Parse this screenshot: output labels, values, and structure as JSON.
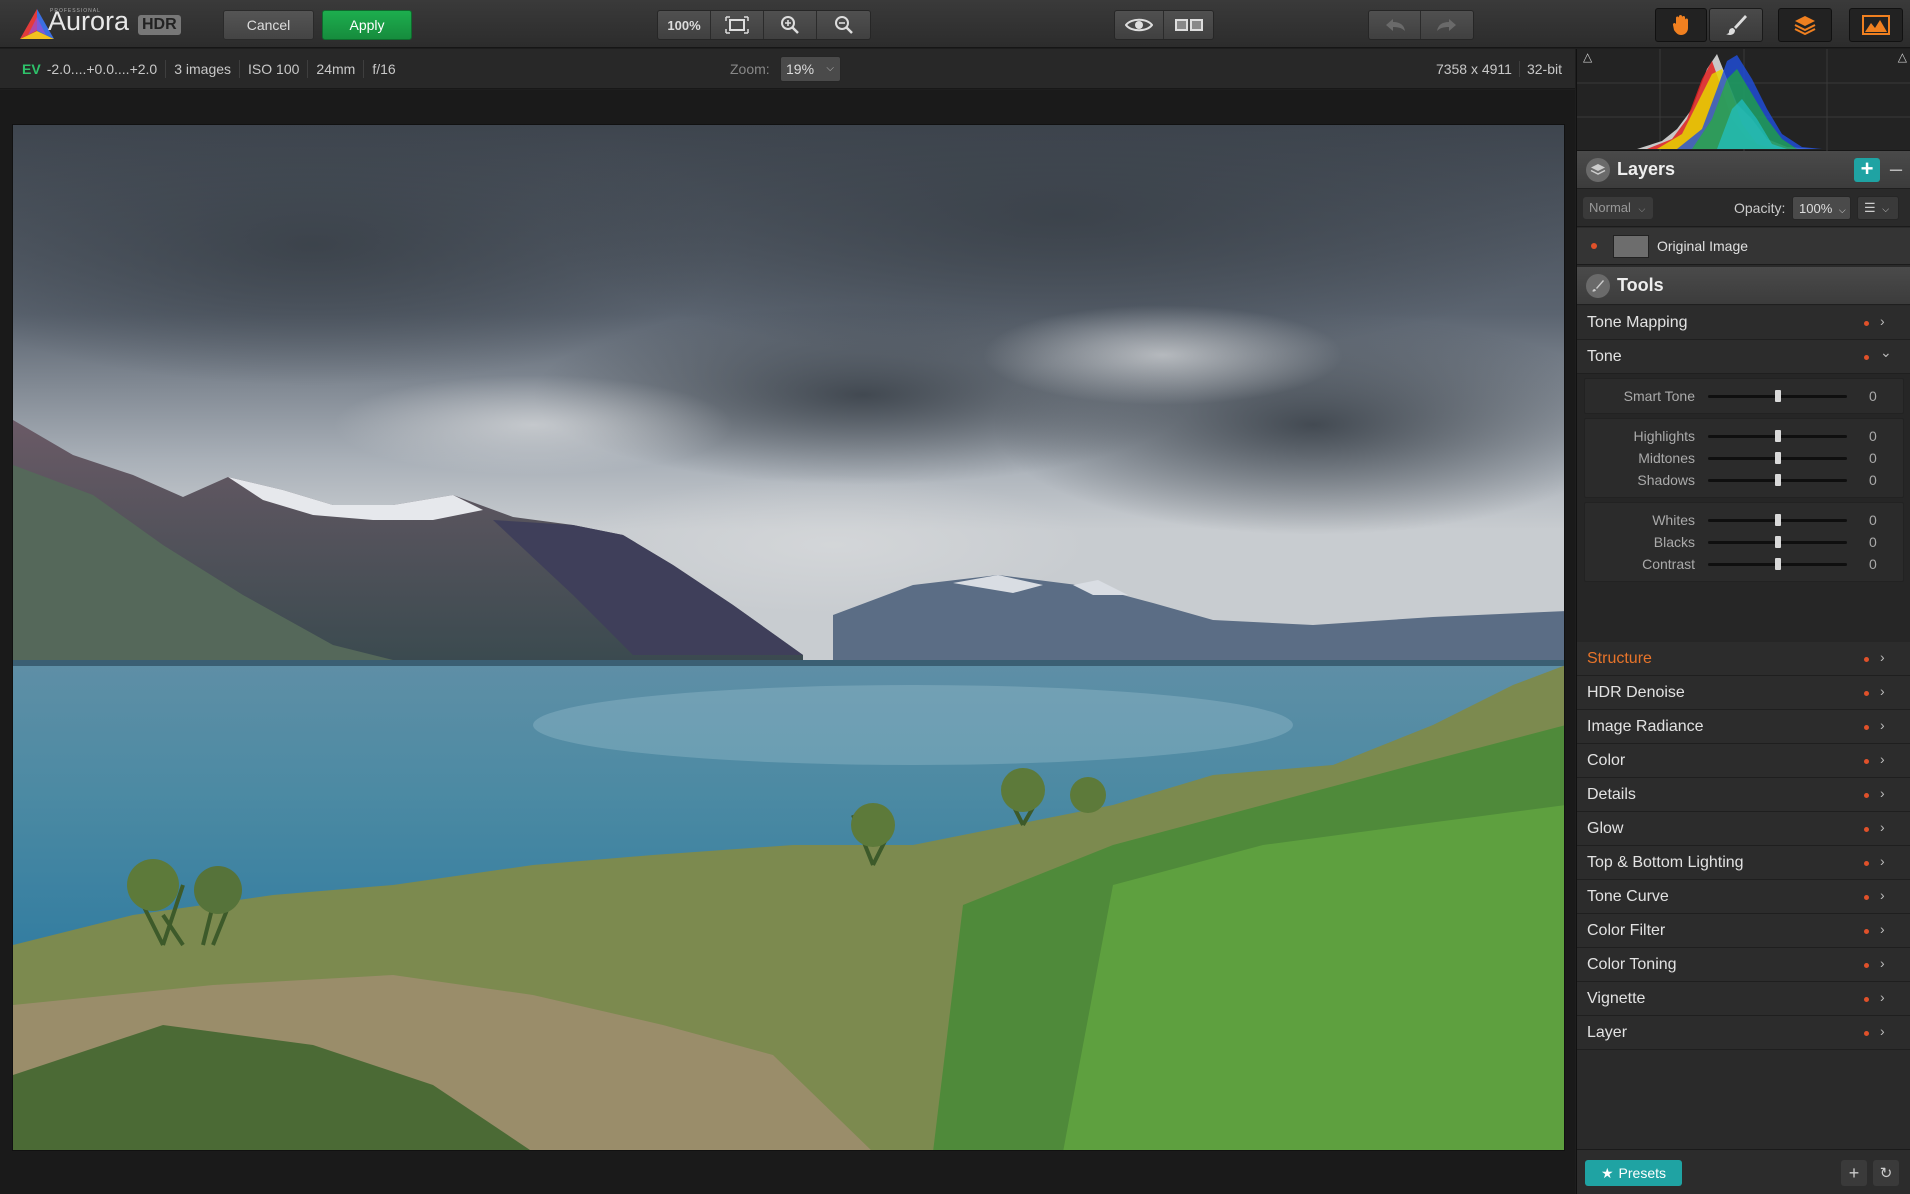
{
  "app": {
    "brand_small": "PROFESSIONAL",
    "brand": "Aurora",
    "brand_badge": "HDR"
  },
  "toolbar": {
    "cancel_label": "Cancel",
    "apply_label": "Apply",
    "zoom_100_label": "100%",
    "icons": [
      "fit-screen-icon",
      "zoom-in-icon",
      "zoom-out-icon",
      "eye-icon",
      "compare-icon",
      "undo-icon",
      "redo-icon",
      "hand-icon",
      "brush-icon",
      "layers-icon",
      "histogram-icon"
    ]
  },
  "infobar": {
    "ev_label": "EV",
    "ev_value": "-2.0....+0.0....+2.0",
    "images": "3 images",
    "iso": "ISO 100",
    "focal": "24mm",
    "aperture": "f/16",
    "zoom_label": "Zoom:",
    "zoom_value": "19%",
    "dimensions": "7358 x 4911",
    "bitdepth": "32-bit"
  },
  "layers": {
    "title": "Layers",
    "blend_mode": "Normal",
    "opacity_label": "Opacity:",
    "opacity_value": "100%",
    "items": [
      {
        "name": "Original Image"
      }
    ]
  },
  "tools": {
    "title": "Tools",
    "items": [
      {
        "label": "Tone Mapping",
        "expanded": false
      },
      {
        "label": "Tone",
        "expanded": true
      },
      {
        "label": "Structure",
        "active": true
      },
      {
        "label": "HDR Denoise"
      },
      {
        "label": "Image Radiance"
      },
      {
        "label": "Color"
      },
      {
        "label": "Details"
      },
      {
        "label": "Glow"
      },
      {
        "label": "Top & Bottom Lighting"
      },
      {
        "label": "Tone Curve"
      },
      {
        "label": "Color Filter"
      },
      {
        "label": "Color Toning"
      },
      {
        "label": "Vignette"
      },
      {
        "label": "Layer"
      }
    ],
    "tone_sliders": [
      {
        "label": "Smart Tone",
        "value": "0",
        "level": 0.5
      },
      {
        "label": "Highlights",
        "value": "0",
        "level": 0.5
      },
      {
        "label": "Midtones",
        "value": "0",
        "level": 0.5
      },
      {
        "label": "Shadows",
        "value": "0",
        "level": 0.5
      },
      {
        "label": "Whites",
        "value": "0",
        "level": 0.5
      },
      {
        "label": "Blacks",
        "value": "0",
        "level": 0.5
      },
      {
        "label": "Contrast",
        "value": "0",
        "level": 0.5
      }
    ]
  },
  "bottom": {
    "presets_label": "Presets"
  },
  "colors": {
    "accent_teal": "#1fa3a3",
    "apply_green": "#1dae4e",
    "active_orange": "#e8742a",
    "dot_red": "#e0512a"
  }
}
